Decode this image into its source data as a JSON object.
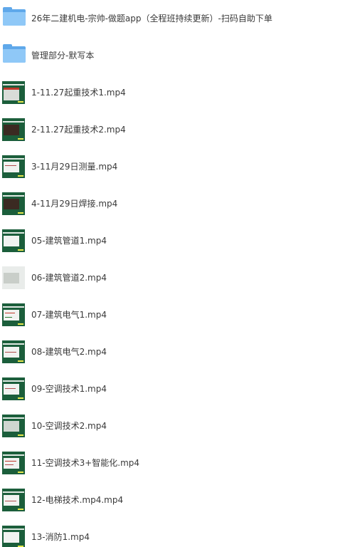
{
  "folders": [
    {
      "name": "26年二建机电-宗帅-做题app（全程班持续更新）-扫码自助下单",
      "icon": "folder-icon"
    },
    {
      "name": "管理部分-默写本",
      "icon": "folder-icon"
    }
  ],
  "files": [
    {
      "name": "1-11.27起重技术1.mp4",
      "icon": "video-thumbnail"
    },
    {
      "name": "2-11.27起重技术2.mp4",
      "icon": "video-thumbnail"
    },
    {
      "name": "3-11月29日测量.mp4",
      "icon": "video-thumbnail"
    },
    {
      "name": "4-11月29日焊接.mp4",
      "icon": "video-thumbnail"
    },
    {
      "name": "05-建筑管道1.mp4",
      "icon": "video-thumbnail"
    },
    {
      "name": "06-建筑管道2.mp4",
      "icon": "video-thumbnail"
    },
    {
      "name": "07-建筑电气1.mp4",
      "icon": "video-thumbnail"
    },
    {
      "name": "08-建筑电气2.mp4",
      "icon": "video-thumbnail"
    },
    {
      "name": "09-空调技术1.mp4",
      "icon": "video-thumbnail"
    },
    {
      "name": "10-空调技术2.mp4",
      "icon": "video-thumbnail"
    },
    {
      "name": "11-空调技术3+智能化.mp4",
      "icon": "video-thumbnail"
    },
    {
      "name": "12-电梯技术.mp4.mp4",
      "icon": "video-thumbnail"
    },
    {
      "name": "13-消防1.mp4",
      "icon": "video-thumbnail"
    }
  ]
}
